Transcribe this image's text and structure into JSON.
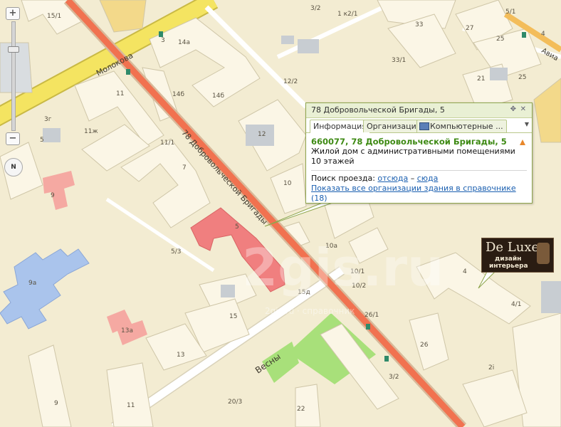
{
  "map": {
    "colors": {
      "background": "#f3ecd2",
      "building": "#fbf6e6",
      "highlight_building": "#f07f7f",
      "main_road": "#f17250",
      "yellow_road": "#f4e461",
      "park": "#a8e07a",
      "school": "#aac4ec",
      "kindergarten": "#f5a9a2"
    },
    "streets": {
      "molokova": "Молокова",
      "dobrovolcheskoy": "78 Добровольческой Бригады",
      "vesny": "Весны",
      "avia": "Авиа"
    },
    "buildings": {
      "b15_1": "15/1",
      "b3_top": "3",
      "b3_2": "3/2",
      "b1k2_1": "1 к2/1",
      "b5_1": "5/1",
      "b33": "33",
      "b27": "27",
      "b25": "25",
      "b4_top": "4",
      "b14a": "14а",
      "b33_1": "33/1",
      "b21": "21",
      "b25_mid": "25",
      "b11": "11",
      "b14b_1": "14б",
      "b14b_2": "14б",
      "b12_2": "12/2",
      "b3g": "3г",
      "b11zh": "11ж",
      "b5_left": "5",
      "b12": "12",
      "b11_1": "11/1",
      "b7": "7",
      "b10": "10",
      "b9": "9",
      "b5_main": "5",
      "b10a": "10а",
      "b5_3": "5/3",
      "b10_1": "10/1",
      "b10_2": "10/2",
      "b15d": "15д",
      "b9a": "9а",
      "b4_right": "4",
      "b4_1": "4/1",
      "b15": "15",
      "b26_1": "26/1",
      "b26": "26",
      "b13a": "13а",
      "b13": "13",
      "b2i": "2i",
      "b3_2_bottom": "3/2",
      "b9_bottom": "9",
      "b11_bottom": "11",
      "b20_3": "20/3",
      "b22": "22"
    },
    "watermark": "2gis.ru",
    "watermark_sub": "2gis.ru · справочник"
  },
  "zoom": {
    "plus": "+",
    "minus": "−",
    "compass": "N"
  },
  "popup": {
    "title": "78 Добровольческой Бригады, 5",
    "tabs": [
      "Информация",
      "Организации",
      "Компьютерные ..."
    ],
    "address": "660077, 78 Добровольческой Бригады, 5",
    "description": "Жилой дом с административными помещениями",
    "floors": "10 этажей",
    "route_label": "Поиск проезда:",
    "route_from": "отсюда",
    "route_dash": "–",
    "route_to": "сюда",
    "all_orgs_link": "Показать все организации здания в справочнике",
    "all_orgs_count": "(18)"
  },
  "ad": {
    "brand": "De Luxe",
    "line1": "дизайн",
    "line2": "интерьера"
  }
}
